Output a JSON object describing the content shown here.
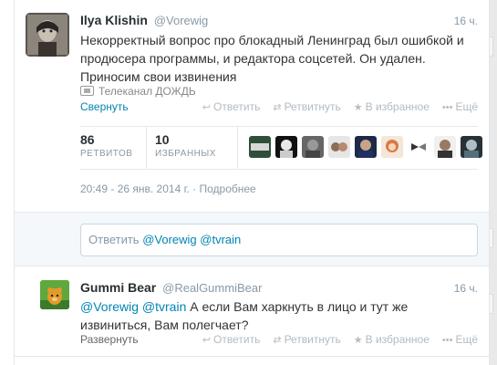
{
  "main_tweet": {
    "fullname": "Ilya Klishin",
    "username": "@Vorewig",
    "time": "16 ч.",
    "text": "Некорректный вопрос про блокадный Ленинград был ошибкой и продюсера программы, и редактора соцсетей. Он удален. Приносим свои извинения",
    "attribution": "Телеканал ДОЖДЬ",
    "collapse_label": "Свернуть",
    "actions": {
      "reply": "Ответить",
      "retweet": "Ретвитнуть",
      "favorite": "В избранное",
      "more": "Ещё"
    },
    "stats": {
      "retweets_count": "86",
      "retweets_label": "РЕТВИТОВ",
      "favorites_count": "10",
      "favorites_label": "ИЗБРАННЫХ"
    },
    "timestamp": "20:49 - 26 янв. 2014 г. · ",
    "details_label": "Подробнее"
  },
  "reply_box": {
    "prefix": "Ответить",
    "mentions": "@Vorewig @tvrain"
  },
  "reply_tweet": {
    "fullname": "Gummi Bear",
    "username": "@RealGummiBear",
    "time": "16 ч.",
    "mentions": "@Vorewig @tvrain",
    "text": " А если Вам харкнуть в лицо и тут же извиниться, Вам полегчает?",
    "expand_label": "Развернуть",
    "actions": {
      "reply": "Ответить",
      "retweet": "Ретвитнуть",
      "favorite": "В избранное",
      "more": "Ещё"
    }
  },
  "colors": {
    "link": "#0084b4",
    "muted": "#8899a6",
    "text": "#333333"
  }
}
